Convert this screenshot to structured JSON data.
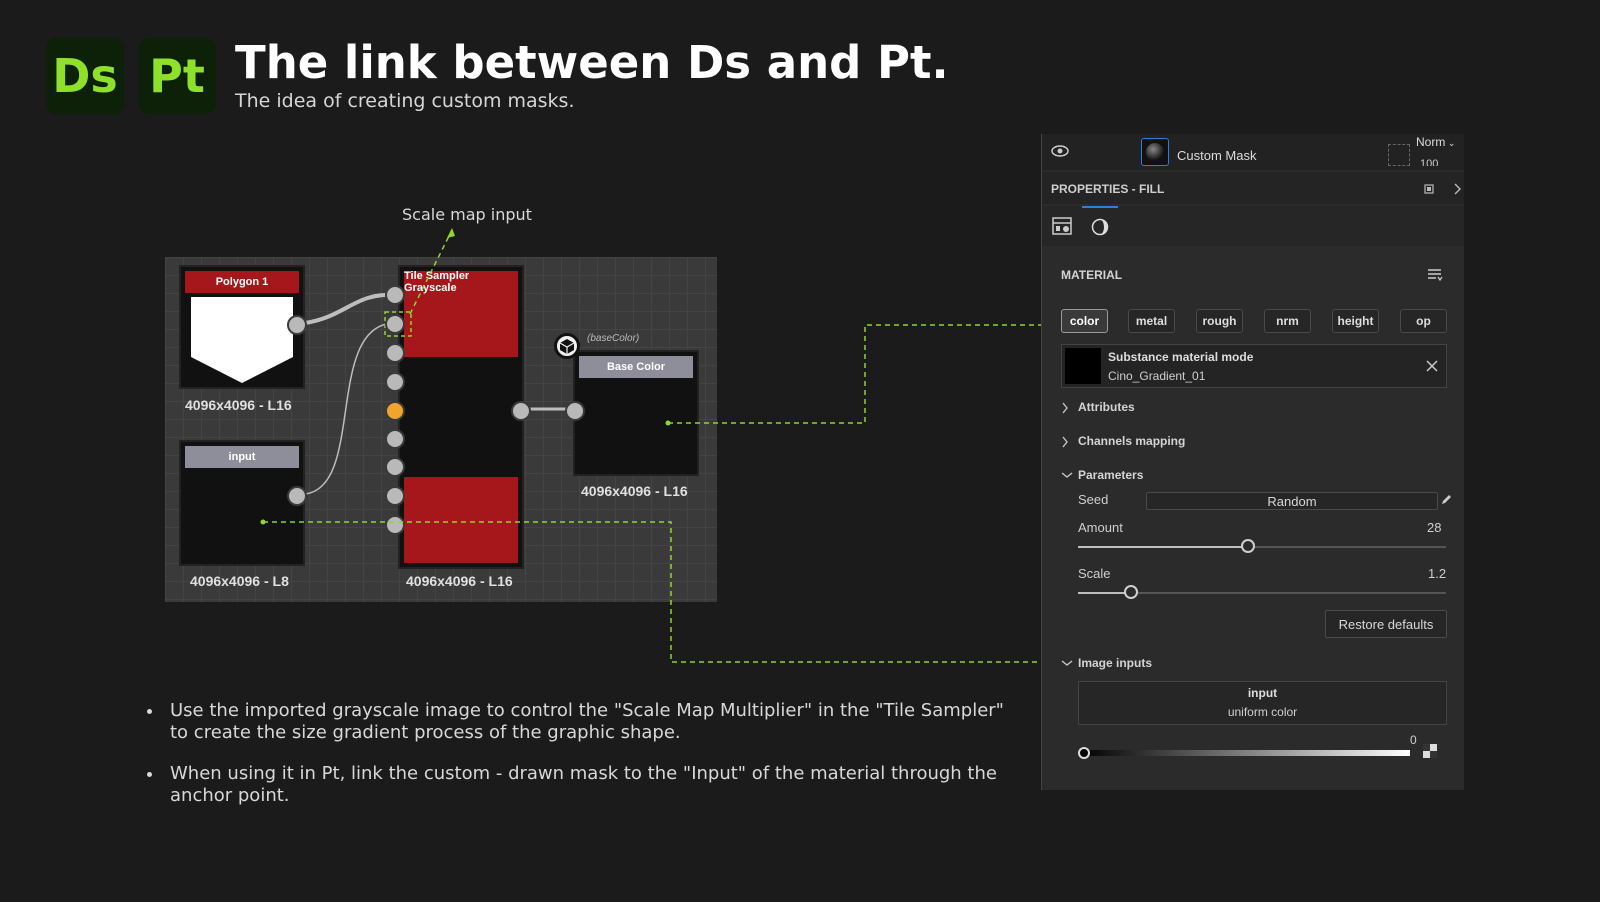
{
  "header": {
    "logo_ds": "Ds",
    "logo_pt": "Pt",
    "title": "The link between Ds and Pt.",
    "subtitle": "The idea of creating custom masks."
  },
  "graph": {
    "callout": "Scale map input",
    "nodes": {
      "polygon": {
        "title": "Polygon 1",
        "label": "4096x4096 - L16"
      },
      "input": {
        "title": "input",
        "label": "4096x4096 - L8"
      },
      "tile_sampler": {
        "title": "Tile Sampler Grayscale",
        "label": "4096x4096 - L16"
      },
      "base_color": {
        "title": "Base Color",
        "label": "4096x4096 - L16",
        "tag": "(baseColor)"
      }
    },
    "colors": {
      "red": "#a6171b",
      "header_gray": "#8e8e9a",
      "port_active": "#f0a62d",
      "link_dash": "#8ed630"
    }
  },
  "bullets": [
    "Use the imported grayscale image to control the \"Scale Map Multiplier\" in the \"Tile Sampler\" to create the size gradient process of the graphic shape.",
    "When using it in Pt, link the custom - drawn mask to the \"Input\" of the material through the anchor point."
  ],
  "panel": {
    "layer": {
      "name": "Custom Mask",
      "blend": "Norm",
      "opacity": "100"
    },
    "properties_title": "PROPERTIES - FILL",
    "material_title": "MATERIAL",
    "channels": [
      "color",
      "metal",
      "rough",
      "nrm",
      "height",
      "op"
    ],
    "material": {
      "mode": "Substance material mode",
      "name": "Cino_Gradient_01"
    },
    "sections": {
      "attributes": "Attributes",
      "channels_mapping": "Channels mapping",
      "parameters": "Parameters",
      "image_inputs": "Image inputs"
    },
    "params": {
      "seed_label": "Seed",
      "seed_value": "Random",
      "amount_label": "Amount",
      "amount_value": "28",
      "amount_fraction": 0.46,
      "scale_label": "Scale",
      "scale_value": "1.2",
      "scale_fraction": 0.14,
      "restore": "Restore defaults"
    },
    "image_input": {
      "name": "input",
      "value": "uniform color",
      "gradient_value": "0"
    }
  }
}
